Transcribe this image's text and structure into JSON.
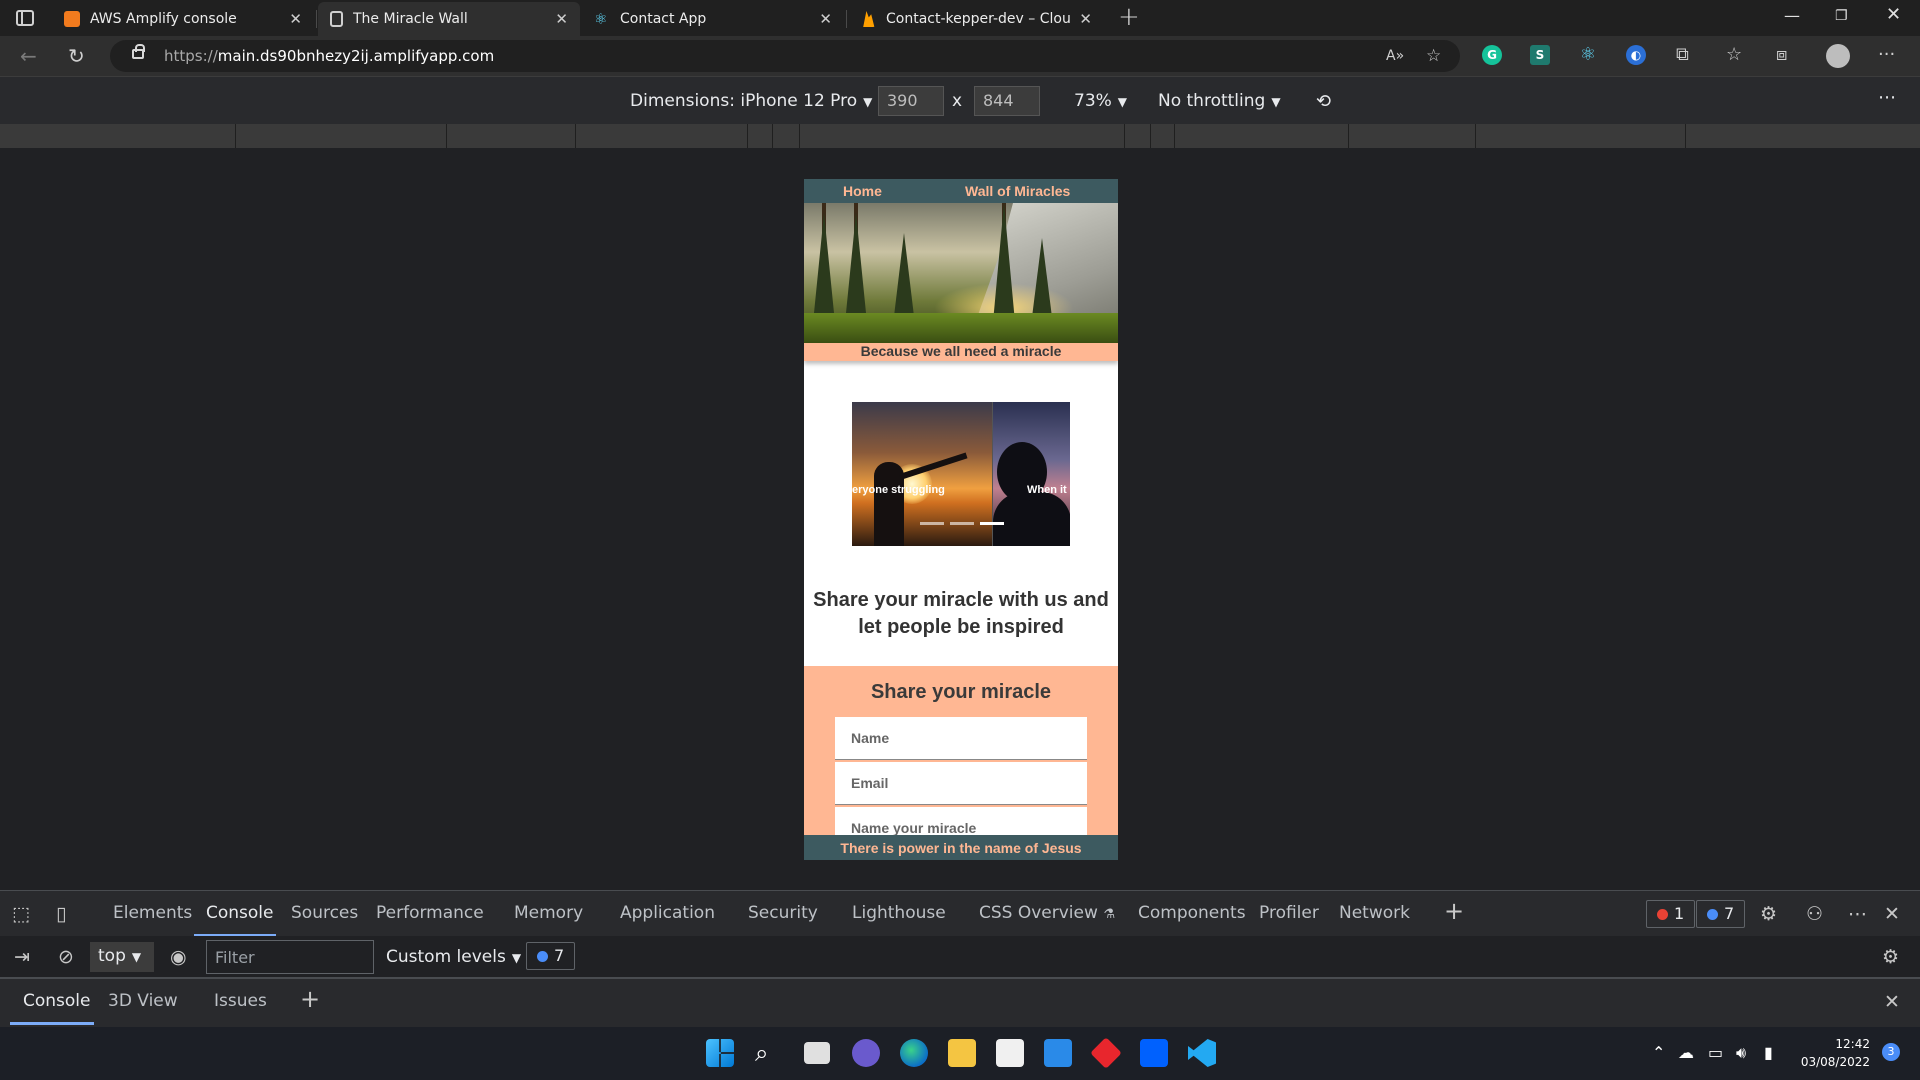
{
  "browser": {
    "tabs": [
      {
        "title": "AWS Amplify console",
        "favicon_color": "#f27b1e",
        "active": false
      },
      {
        "title": "The Miracle Wall",
        "favicon_color": "#2f2f2f",
        "active": true
      },
      {
        "title": "Contact App",
        "favicon_color": "#61dafb",
        "active": false
      },
      {
        "title": "Contact-kepper-dev – Cloud Fire",
        "favicon_color": "#ffa000",
        "active": false
      }
    ],
    "url_prefix": "https://",
    "url_host": "main.ds90bnhezy2ij.amplifyapp.com"
  },
  "device_toolbar": {
    "dimensions_label": "Dimensions: iPhone 12 Pro",
    "width": "390",
    "times": "x",
    "height": "844",
    "zoom": "73%",
    "throttling": "No throttling"
  },
  "site": {
    "nav": {
      "home": "Home",
      "wall": "Wall of Miracles"
    },
    "tagline": "Because we all need a miracle",
    "carousel": {
      "caption_1": "eryone struggling",
      "caption_2": "When it"
    },
    "headline": "Share your miracle with us and let people be inspired",
    "form": {
      "title": "Share your miracle",
      "name_placeholder": "Name",
      "email_placeholder": "Email",
      "miracle_placeholder": "Name your miracle"
    },
    "footer": "There is power in the name of Jesus",
    "colors": {
      "accent": "#ffb793",
      "nav_bg": "#3d5a60"
    }
  },
  "devtools": {
    "tabs": [
      "Elements",
      "Console",
      "Sources",
      "Performance",
      "Memory",
      "Application",
      "Security",
      "Lighthouse",
      "CSS Overview",
      "Components",
      "Profiler",
      "Network"
    ],
    "active_tab": "Console",
    "error_count": "1",
    "message_count": "7",
    "context": "top",
    "filter_placeholder": "Filter",
    "levels": "Custom levels",
    "console_messages": "7",
    "drawer_tabs": [
      "Console",
      "3D View",
      "Issues"
    ]
  },
  "taskbar": {
    "time": "12:42",
    "date": "03/08/2022",
    "notification_count": "3"
  }
}
